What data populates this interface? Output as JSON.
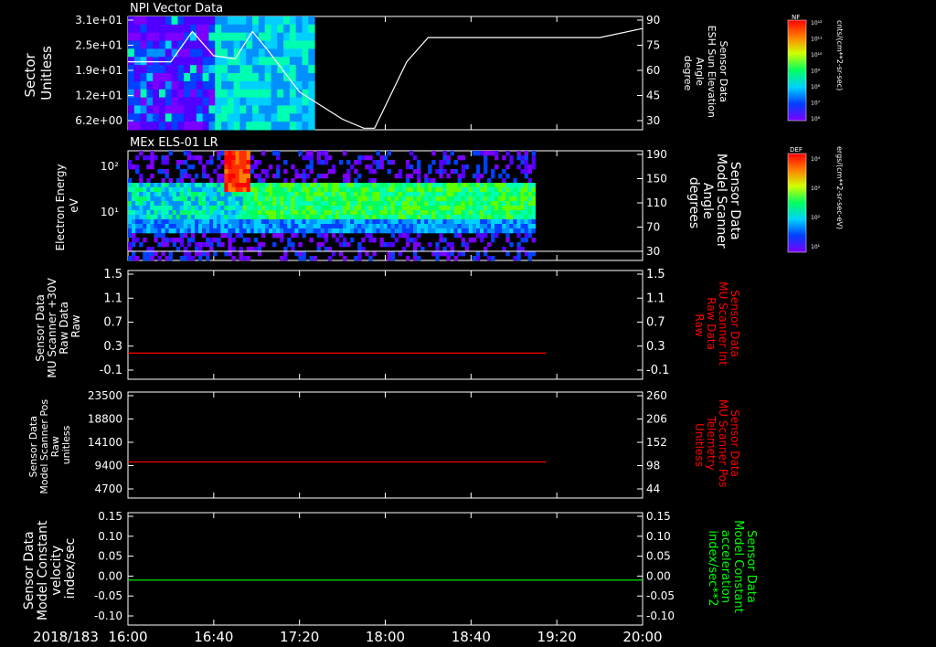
{
  "date_label": "2018/183",
  "time_ticks": [
    "16:00",
    "16:40",
    "17:20",
    "18:00",
    "18:40",
    "19:20",
    "20:00"
  ],
  "colors": {
    "white": "#ffffff",
    "red": "#ff0000",
    "green": "#00ff00",
    "bg": "#000000"
  },
  "colorbar1": {
    "label": "NF",
    "ticks": [
      "10¹²",
      "10¹¹",
      "10¹⁰",
      "10⁹",
      "10⁸",
      "10⁷",
      "10⁶"
    ],
    "unit": "cnts/(cm**2-sr-sec)"
  },
  "colorbar2": {
    "label": "DEF",
    "ticks": [
      "10⁴",
      "10³",
      "10²",
      "10¹"
    ],
    "unit": "ergs/(cm**2-sr-sec-eV)"
  },
  "chart_data": [
    {
      "type": "heatmap",
      "title": "NPI Vector Data",
      "ylabel_lines": [
        "Sector",
        "Unitless"
      ],
      "yticks": [
        "3.1e+01",
        "2.5e+01",
        "1.9e+01",
        "1.2e+01",
        "6.2e+00"
      ],
      "y2label_lines": [
        "Sensor Data",
        "ESH Sun Elevation",
        "Angle",
        "degree"
      ],
      "y2ticks": [
        "90",
        "75",
        "60",
        "45",
        "30"
      ],
      "y2lim": [
        15,
        90
      ],
      "heatmap_time_range": [
        "16:00",
        "17:27"
      ],
      "overlay_line": {
        "color": "white",
        "x": [
          "16:00",
          "16:20",
          "16:30",
          "16:40",
          "16:50",
          "16:58",
          "17:05",
          "17:20",
          "17:40",
          "17:50",
          "17:55",
          "18:10",
          "18:20",
          "19:40",
          "20:00"
        ],
        "y": [
          60,
          60,
          80,
          64,
          62,
          80,
          68,
          40,
          22,
          16,
          16,
          60,
          76,
          76,
          82
        ]
      }
    },
    {
      "type": "heatmap",
      "title": "MEx ELS-01 LR",
      "ylabel_lines": [
        "Electron Energy",
        "eV"
      ],
      "yticks": [
        "10²",
        "10¹"
      ],
      "y2label_lines": [
        "Sensor Data",
        "Model Scanner",
        "Angle",
        "degrees"
      ],
      "y2ticks": [
        "190",
        "150",
        "110",
        "70",
        "30"
      ],
      "heatmap_time_range": [
        "16:00",
        "19:10"
      ],
      "overlay_line": {
        "color": "white",
        "x": [
          "16:00",
          "20:00"
        ],
        "y": [
          10,
          10
        ]
      }
    },
    {
      "type": "line",
      "ylabel_lines": [
        "Sensor Data",
        "MU Scanner +30V",
        "Raw Data",
        "Raw"
      ],
      "yticks": [
        "1.5",
        "1.1",
        "0.7",
        "0.3",
        "-0.1"
      ],
      "y2label_lines": [
        "Sensor Data",
        "MU Scanner Int",
        "Raw Data",
        "Raw"
      ],
      "y2ticks": [
        "1.5",
        "1.1",
        "0.7",
        "0.3",
        "-0.1"
      ],
      "ylim": [
        -0.5,
        1.5
      ],
      "series": [
        {
          "color": "red",
          "x": [
            "16:00",
            "19:15"
          ],
          "y": [
            -0.02,
            -0.02
          ]
        }
      ]
    },
    {
      "type": "line",
      "ylabel_lines": [
        "Sensor Data",
        "Model Scanner Pos",
        "Raw",
        "unitless"
      ],
      "yticks": [
        "23500",
        "18800",
        "14100",
        "9400",
        "4700"
      ],
      "y2label_lines": [
        "Sensor Data",
        "MU Scanner Pos",
        "Telemetry",
        "Unitless"
      ],
      "y2ticks": [
        "260",
        "206",
        "152",
        "98",
        "44"
      ],
      "ylim": [
        0,
        23500
      ],
      "series": [
        {
          "color": "red",
          "x": [
            "16:00",
            "19:15"
          ],
          "y": [
            8000,
            8000
          ]
        }
      ]
    },
    {
      "type": "line",
      "ylabel_lines": [
        "Sensor Data",
        "Model Constant",
        "velocity",
        "index/sec"
      ],
      "yticks": [
        "0.15",
        "0.10",
        "0.05",
        "0.00",
        "-0.05",
        "-0.10"
      ],
      "y2label_lines": [
        "Sensor Data",
        "Model Constant",
        "acceleration",
        "index/sec**2"
      ],
      "y2ticks": [
        "0.15",
        "0.10",
        "0.05",
        "0.00",
        "-0.05",
        "-0.10"
      ],
      "ylim": [
        -0.1,
        0.15
      ],
      "series": [
        {
          "color": "green",
          "x": [
            "16:00",
            "20:00"
          ],
          "y": [
            0,
            0
          ]
        }
      ]
    }
  ]
}
